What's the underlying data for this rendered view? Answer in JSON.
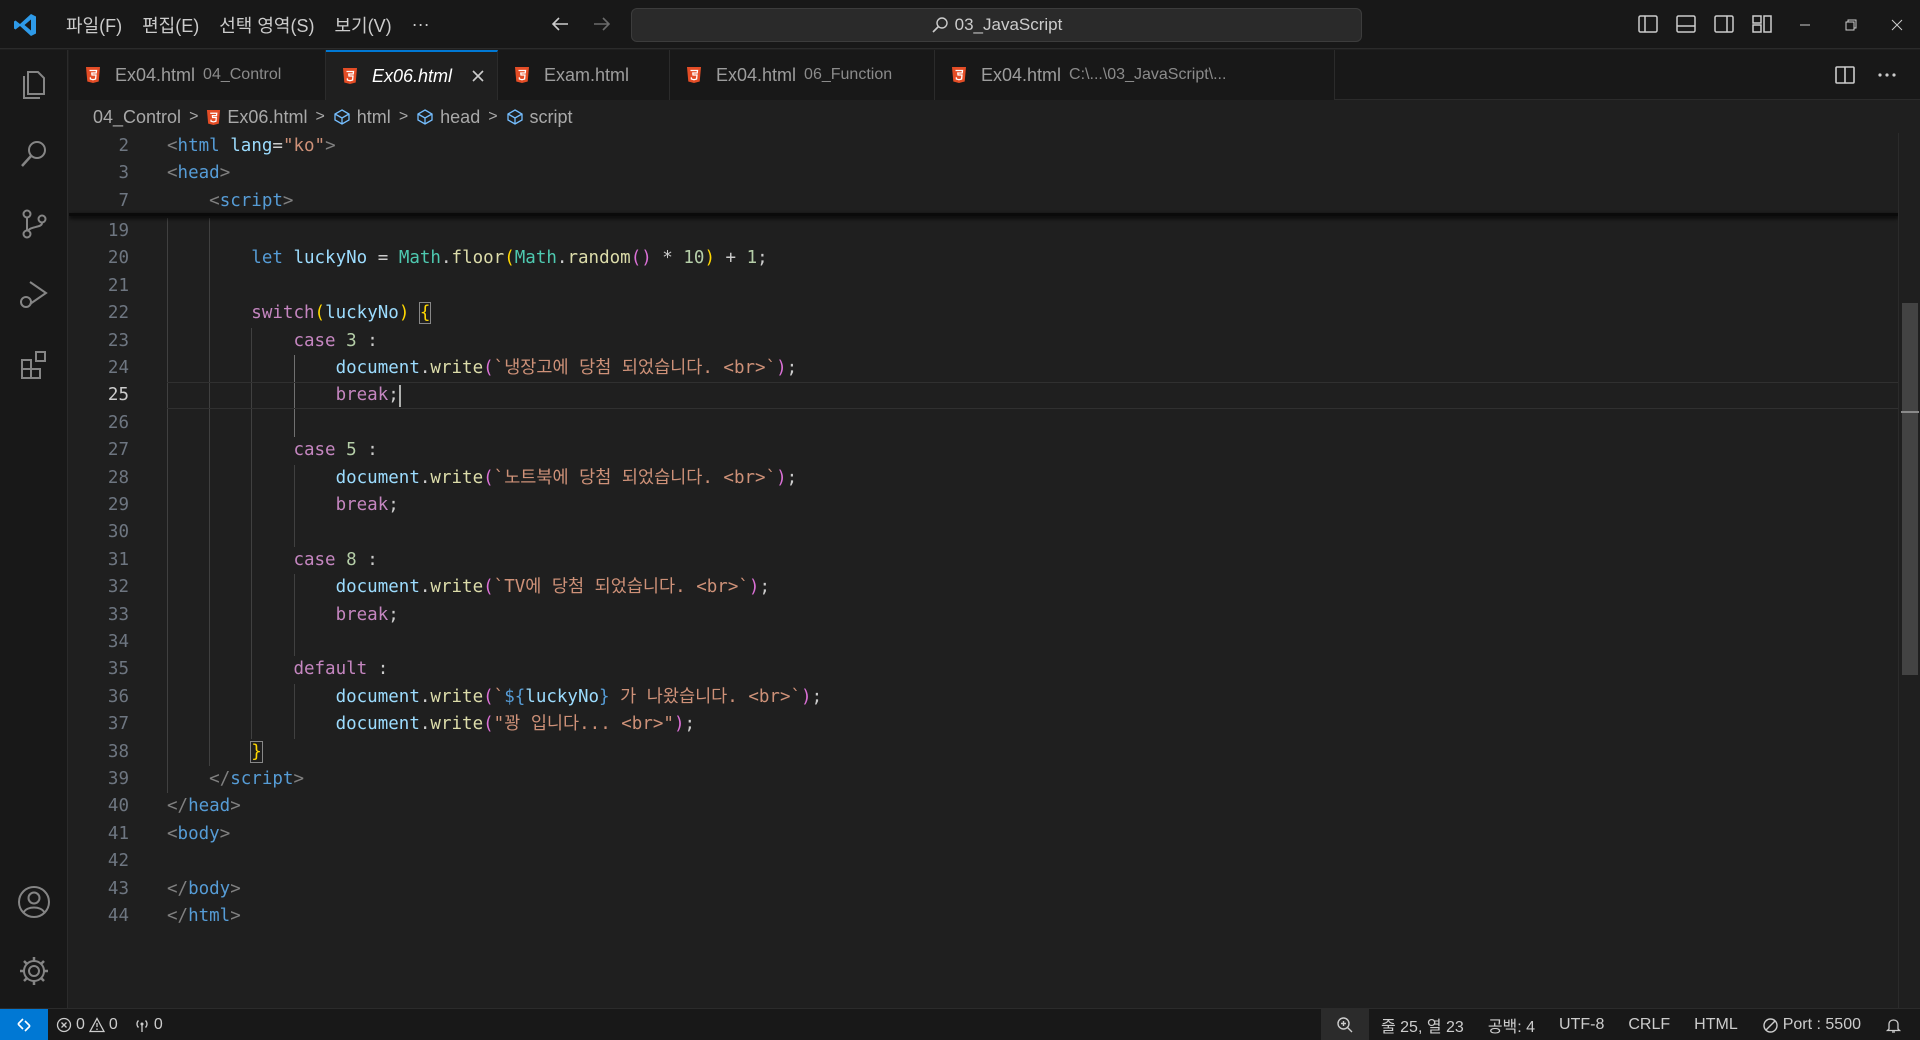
{
  "window": {
    "search_text": "03_JavaScript",
    "menu": [
      "파일(F)",
      "편집(E)",
      "선택 영역(S)",
      "보기(V)",
      "···"
    ]
  },
  "tabs": [
    {
      "label": "Ex04.html",
      "desc": "04_Control",
      "active": false
    },
    {
      "label": "Ex06.html",
      "desc": "",
      "active": true
    },
    {
      "label": "Exam.html",
      "desc": "",
      "active": false
    },
    {
      "label": "Ex04.html",
      "desc": "06_Function",
      "active": false
    },
    {
      "label": "Ex04.html",
      "desc": "C:\\...\\03_JavaScript\\...",
      "active": false
    }
  ],
  "breadcrumb": [
    "04_Control",
    "Ex06.html",
    "html",
    "head",
    "script"
  ],
  "editor": {
    "sticky_lines": [
      {
        "num": "2",
        "html": "<span class=\"p\">&lt;</span><span class=\"t\">html</span> <span class=\"a\">lang</span>=<span class=\"s\">\"ko\"</span><span class=\"p\">&gt;</span>"
      },
      {
        "num": "3",
        "html": "<span class=\"p\">&lt;</span><span class=\"t\">head</span><span class=\"p\">&gt;</span>"
      },
      {
        "num": "7",
        "html": "    <span class=\"p\">&lt;</span><span class=\"t\">script</span><span class=\"p\">&gt;</span>"
      }
    ],
    "current_line": "25",
    "lines": [
      {
        "num": "19",
        "html": ""
      },
      {
        "num": "20",
        "html": "        <span class=\"k\">let</span> <span class=\"a\">luckyNo</span> = <span class=\"c\">Math</span>.<span class=\"f\">floor</span><span class=\"br1\">(</span><span class=\"c\">Math</span>.<span class=\"f\">random</span><span class=\"br2\">()</span> * <span class=\"n\">10</span><span class=\"br1\">)</span> + <span class=\"n\">1</span>;"
      },
      {
        "num": "21",
        "html": ""
      },
      {
        "num": "22",
        "html": "        <span class=\"kc\">switch</span><span class=\"br1\">(</span><span class=\"a\">luckyNo</span><span class=\"br1\">)</span> <span class=\"br1 hl-br\">{</span>"
      },
      {
        "num": "23",
        "html": "            <span class=\"kc\">case</span> <span class=\"n\">3</span> :"
      },
      {
        "num": "24",
        "html": "                <span class=\"a\">document</span>.<span class=\"f\">write</span><span class=\"br2\">(</span><span class=\"s\">`냉장고에 당첨 되었습니다. &lt;br&gt;`</span><span class=\"br2\">)</span>;"
      },
      {
        "num": "25",
        "html": "                <span class=\"kc\">break</span>;"
      },
      {
        "num": "26",
        "html": ""
      },
      {
        "num": "27",
        "html": "            <span class=\"kc\">case</span> <span class=\"n\">5</span> :"
      },
      {
        "num": "28",
        "html": "                <span class=\"a\">document</span>.<span class=\"f\">write</span><span class=\"br2\">(</span><span class=\"s\">`노트북에 당첨 되었습니다. &lt;br&gt;`</span><span class=\"br2\">)</span>;"
      },
      {
        "num": "29",
        "html": "                <span class=\"kc\">break</span>;"
      },
      {
        "num": "30",
        "html": ""
      },
      {
        "num": "31",
        "html": "            <span class=\"kc\">case</span> <span class=\"n\">8</span> :"
      },
      {
        "num": "32",
        "html": "                <span class=\"a\">document</span>.<span class=\"f\">write</span><span class=\"br2\">(</span><span class=\"s\">`TV에 당첨 되었습니다. &lt;br&gt;`</span><span class=\"br2\">)</span>;"
      },
      {
        "num": "33",
        "html": "                <span class=\"kc\">break</span>;"
      },
      {
        "num": "34",
        "html": ""
      },
      {
        "num": "35",
        "html": "            <span class=\"kc\">default</span> :"
      },
      {
        "num": "36",
        "html": "                <span class=\"a\">document</span>.<span class=\"f\">write</span><span class=\"br2\">(</span><span class=\"s\">`</span><span class=\"k\">${</span><span class=\"a\">luckyNo</span><span class=\"k\">}</span><span class=\"s\"> 가 나왔습니다. &lt;br&gt;`</span><span class=\"br2\">)</span>;"
      },
      {
        "num": "37",
        "html": "                <span class=\"a\">document</span>.<span class=\"f\">write</span><span class=\"br2\">(</span><span class=\"s\">\"꽝 입니다... &lt;br&gt;\"</span><span class=\"br2\">)</span>;"
      },
      {
        "num": "38",
        "html": "        <span class=\"br1 hl-br\">}</span>"
      },
      {
        "num": "39",
        "html": "    <span class=\"p\">&lt;/</span><span class=\"t\">script</span><span class=\"p\">&gt;</span>"
      },
      {
        "num": "40",
        "html": "<span class=\"p\">&lt;/</span><span class=\"t\">head</span><span class=\"p\">&gt;</span>"
      },
      {
        "num": "41",
        "html": "<span class=\"p\">&lt;</span><span class=\"t\">body</span><span class=\"p\">&gt;</span>"
      },
      {
        "num": "42",
        "html": ""
      },
      {
        "num": "43",
        "html": "<span class=\"p\">&lt;/</span><span class=\"t\">body</span><span class=\"p\">&gt;</span>"
      },
      {
        "num": "44",
        "html": "<span class=\"p\">&lt;/</span><span class=\"t\">html</span><span class=\"p\">&gt;</span>"
      }
    ]
  },
  "status": {
    "errors": "0",
    "warnings": "0",
    "ports": "0",
    "position": "줄 25, 열 23",
    "indent": "공백: 4",
    "encoding": "UTF-8",
    "eol": "CRLF",
    "language": "HTML",
    "port": "Port : 5500"
  },
  "colors": {
    "accent": "#0078d4",
    "html_icon": "#e44d26"
  }
}
